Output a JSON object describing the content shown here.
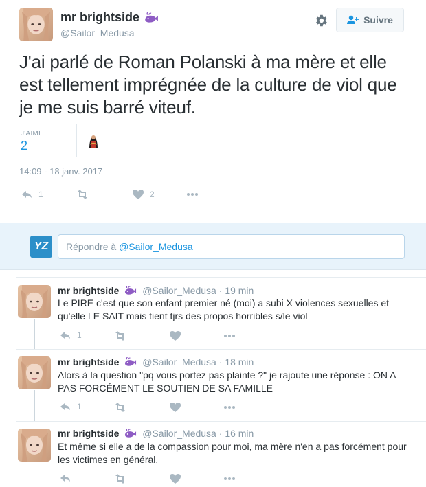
{
  "main_tweet": {
    "name": "mr brightside",
    "handle": "@Sailor_Medusa",
    "follow_label": "Suivre",
    "text": "J'ai parlé de Roman Polanski à ma mère et elle est tellement imprégnée de la culture de viol que je me suis barré viteuf.",
    "likes_label": "J'AIME",
    "likes_count": "2",
    "timestamp": "14:09 - 18 janv. 2017",
    "actions": {
      "reply_count": "1",
      "retweet_count": "",
      "like_count": "2"
    }
  },
  "reply_box": {
    "prefix": "Répondre à ",
    "mention": "@Sailor_Medusa",
    "logo_text": "YZ"
  },
  "replies": [
    {
      "name": "mr brightside",
      "handle": "@Sailor_Medusa",
      "time": "19 min",
      "text": "Le PIRE c'est que son enfant premier né (moi) a subi X violences sexuelles et qu'elle LE SAIT mais tient tjrs des propos horribles s/le viol",
      "reply_count": "1"
    },
    {
      "name": "mr brightside",
      "handle": "@Sailor_Medusa",
      "time": "18 min",
      "text": "Alors à la question \"pq vous portez pas plainte ?\" je rajoute une réponse : ON A PAS FORCÉMENT LE SOUTIEN DE SA FAMILLE",
      "reply_count": "1"
    },
    {
      "name": "mr brightside",
      "handle": "@Sailor_Medusa",
      "time": "16 min",
      "text": "Et même si elle a de la compassion pour moi, ma mère n'en a pas forcément pour les victimes en général.",
      "reply_count": ""
    }
  ],
  "colors": {
    "link_blue": "#1b95e0",
    "muted": "#8899a6",
    "icon_gray": "#aab8c2",
    "reply_bg": "#e8f3fb",
    "whale_purple": "#8e5cc4"
  }
}
